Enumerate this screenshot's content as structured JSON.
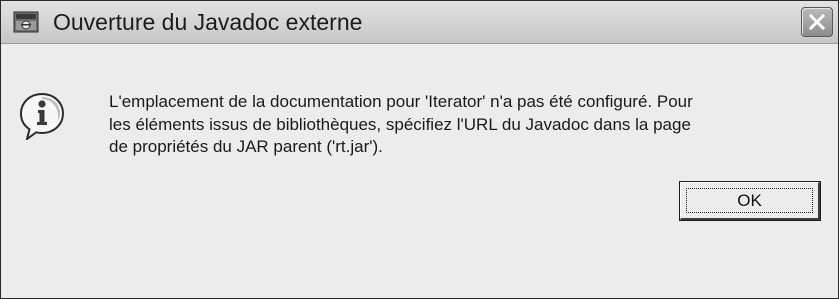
{
  "window": {
    "title": "Ouverture du Javadoc externe"
  },
  "icons": {
    "app": "eclipse-app-icon",
    "close": "close-icon",
    "info": "info-icon"
  },
  "dialog": {
    "message": "L'emplacement de la documentation pour 'Iterator' n'a pas été configuré. Pour\nles éléments issus de bibliothèques, spécifiez l'URL du Javadoc dans la page\nde propriétés du JAR parent ('rt.jar').",
    "ok_label": "OK"
  },
  "colors": {
    "titlebar": "#d4d4d4",
    "dialog_background": "#ececec",
    "close_button": "#9a9a9a"
  }
}
